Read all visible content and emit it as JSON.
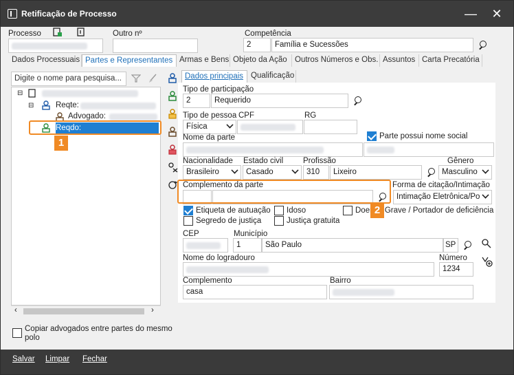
{
  "window": {
    "title": "Retificação de Processo",
    "min": "—",
    "close": "✕"
  },
  "header": {
    "processo_label": "Processo",
    "outro_label": "Outro nº",
    "competencia_label": "Competência",
    "competencia_code": "2",
    "competencia_value": "Família e Sucessões"
  },
  "tabs": [
    "Dados Processuais",
    "Partes e Representantes",
    "Armas e Bens",
    "Objeto da Ação",
    "Outros Números e Obs.",
    "Assuntos",
    "Carta Precatória"
  ],
  "left": {
    "search_placeholder": "Digite o nome para pesquisa...",
    "tree": {
      "reqte": "Reqte:",
      "advogado": "Advogado:",
      "reqdo": "Reqdo:"
    },
    "copy_label": "Copiar advogados entre partes do mesmo polo"
  },
  "subtabs": [
    "Dados principais",
    "Qualificação"
  ],
  "form": {
    "tipo_participacao_label": "Tipo de participação",
    "tipo_participacao_code": "2",
    "tipo_participacao_value": "Requerido",
    "tipo_pessoa_label": "Tipo de pessoa",
    "tipo_pessoa_value": "Física",
    "cpf_label": "CPF",
    "rg_label": "RG",
    "nome_label": "Nome da parte",
    "nome_social_label": "Parte possui nome social",
    "nacionalidade_label": "Nacionalidade",
    "nacionalidade_value": "Brasileiro",
    "estado_civil_label": "Estado civil",
    "estado_civil_value": "Casado",
    "profissao_label": "Profissão",
    "profissao_code": "310",
    "profissao_value": "Lixeiro",
    "genero_label": "Gênero",
    "genero_value": "Masculino",
    "complemento_parte_label": "Complemento da parte",
    "forma_citacao_label": "Forma de citação/Intimação",
    "forma_citacao_value": "Intimação Eletrônica/Po",
    "etiqueta_label": "Etiqueta de autuação",
    "idoso_label": "Idoso",
    "doenca_label": "Doença Grave / Portador de deficiência",
    "segredo_label": "Segredo de justiça",
    "gratuita_label": "Justiça gratuita",
    "cep_label": "CEP",
    "municipio_label": "Município",
    "municipio_code": "1",
    "municipio_value": "São Paulo",
    "uf_value": "SP",
    "logradouro_label": "Nome do logradouro",
    "numero_label": "Número",
    "numero_value": "1234",
    "complemento_label": "Complemento",
    "complemento_value": "casa",
    "bairro_label": "Bairro"
  },
  "badges": {
    "one": "1",
    "two": "2"
  },
  "footer": {
    "salvar": "Salvar",
    "limpar": "Limpar",
    "fechar": "Fechar"
  },
  "colors": {
    "titlebar": "#3c3c3c",
    "accent": "#1e6fb8",
    "highlight": "#f08a24",
    "selection": "#1f7fd2"
  }
}
